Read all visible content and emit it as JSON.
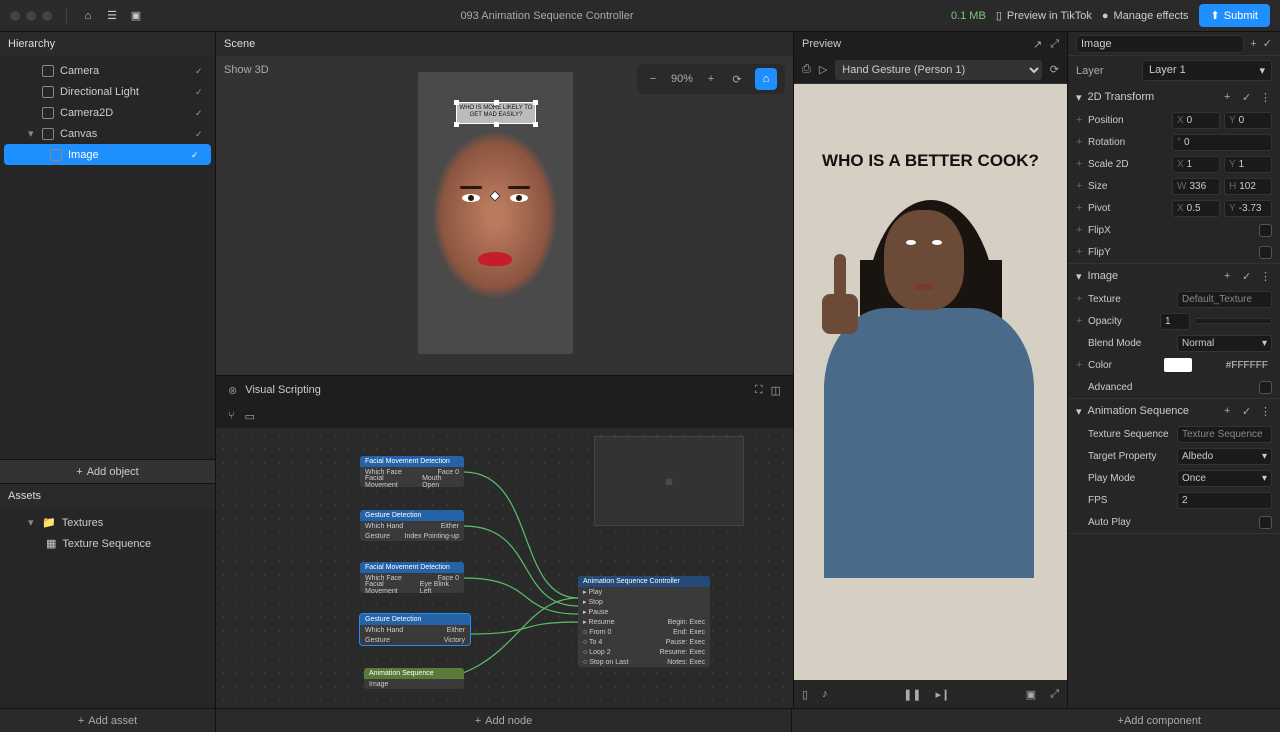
{
  "topbar": {
    "title": "093 Animation Sequence Controller",
    "size": "0.1 MB",
    "preview": "Preview in TikTok",
    "manage": "Manage effects",
    "submit": "Submit"
  },
  "hierarchy": {
    "title": "Hierarchy",
    "items": [
      {
        "label": "Camera",
        "indent": 1,
        "checked": true
      },
      {
        "label": "Directional Light",
        "indent": 1,
        "checked": true
      },
      {
        "label": "Camera2D",
        "indent": 1,
        "checked": true
      },
      {
        "label": "Canvas",
        "indent": 1,
        "caret": true,
        "checked": true
      },
      {
        "label": "Image",
        "indent": 2,
        "selected": true,
        "checked": true
      }
    ],
    "add": "Add object"
  },
  "assets": {
    "title": "Assets",
    "items": [
      {
        "label": "Textures",
        "indent": 1,
        "caret": true,
        "folder": true
      },
      {
        "label": "Texture Sequence",
        "indent": 2
      }
    ],
    "add": "Add asset"
  },
  "scene": {
    "title": "Scene",
    "show3d": "Show 3D",
    "zoom": "90%",
    "text": "WHO IS MORE LIKELY TO GET MAD EASILY?"
  },
  "vs": {
    "title": "Visual Scripting",
    "add": "Add node",
    "nodes": {
      "fmd1": {
        "title": "Facial Movement Detection",
        "rows": [
          [
            "Which Face",
            "Face 0"
          ],
          [
            "Facial Movement",
            "Mouth Open"
          ]
        ]
      },
      "gd1": {
        "title": "Gesture Detection",
        "rows": [
          [
            "Which Hand",
            "Either"
          ],
          [
            "Gesture",
            "Index Pointing-up"
          ]
        ]
      },
      "fmd2": {
        "title": "Facial Movement Detection",
        "rows": [
          [
            "Which Face",
            "Face 0"
          ],
          [
            "Facial Movement",
            "Eye Blink Left"
          ]
        ]
      },
      "gd2": {
        "title": "Gesture Detection",
        "rows": [
          [
            "Which Hand",
            "Either"
          ],
          [
            "Gesture",
            "Victory"
          ]
        ]
      },
      "as": {
        "title": "Animation Sequence",
        "rows": [
          [
            "Image",
            ""
          ]
        ]
      },
      "ctrl": {
        "title": "Animation Sequence Controller",
        "inputs": [
          "Play",
          "Stop",
          "Pause",
          "Resume",
          "From",
          "To",
          "Loop",
          "Stop on Last"
        ],
        "outputs": [
          "",
          "",
          "",
          "",
          "Begin: Exec",
          "End: Exec",
          "Pause: Exec",
          "Resume: Exec",
          "Notes: Exec"
        ],
        "vals": [
          "",
          "",
          "",
          "",
          "0",
          "4",
          "2",
          ""
        ]
      }
    }
  },
  "preview": {
    "title": "Preview",
    "gesture": "Hand Gesture (Person 1)",
    "caption": "WHO IS A BETTER COOK?"
  },
  "inspector": {
    "name": "Image",
    "layer_lbl": "Layer",
    "layer": "Layer 1",
    "sections": {
      "transform": {
        "title": "2D Transform",
        "position": {
          "lbl": "Position",
          "x": "0",
          "y": "0"
        },
        "rotation": {
          "lbl": "Rotation",
          "v": "0"
        },
        "scale": {
          "lbl": "Scale 2D",
          "x": "1",
          "y": "1"
        },
        "size": {
          "lbl": "Size",
          "w": "336",
          "h": "102"
        },
        "pivot": {
          "lbl": "Pivot",
          "x": "0.5",
          "y": "-3.73"
        },
        "flipx": "FlipX",
        "flipy": "FlipY"
      },
      "image": {
        "title": "Image",
        "texture": {
          "lbl": "Texture",
          "v": "Default_Texture"
        },
        "opacity": {
          "lbl": "Opacity",
          "v": "1"
        },
        "blend": {
          "lbl": "Blend Mode",
          "v": "Normal"
        },
        "color": {
          "lbl": "Color",
          "v": "#FFFFFF"
        },
        "advanced": "Advanced"
      },
      "anim": {
        "title": "Animation Sequence",
        "texseq": {
          "lbl": "Texture Sequence",
          "v": "Texture Sequence"
        },
        "target": {
          "lbl": "Target Property",
          "v": "Albedo"
        },
        "playmode": {
          "lbl": "Play Mode",
          "v": "Once"
        },
        "fps": {
          "lbl": "FPS",
          "v": "2"
        },
        "autoplay": "Auto Play"
      }
    },
    "add": "Add component"
  }
}
